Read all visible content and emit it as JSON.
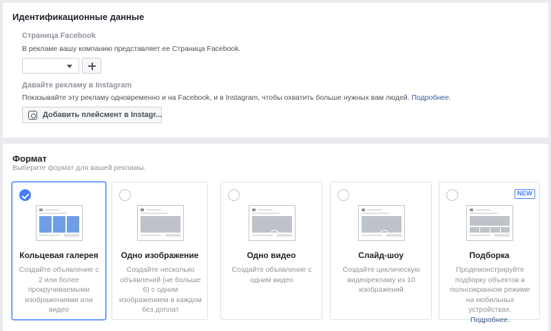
{
  "identity": {
    "title": "Идентификационные данные",
    "fb_heading": "Страница Facebook",
    "fb_desc": "В рекламе вашу компанию представляет ее Страница Facebook.",
    "page_select_value": "",
    "ig_heading": "Давайте рекламу в Instagram",
    "ig_desc": "Показывайте эту рекламу одновременно и на Facebook, и в Instagram, чтобы охватить больше нужных вам людей.",
    "ig_link": "Подробнее.",
    "ig_button": "Добавить плейсмент в Instagr..."
  },
  "format": {
    "title": "Формат",
    "subtitle": "Выберите формат для вашей рекламы.",
    "cards": [
      {
        "title": "Кольцевая галерея",
        "desc": "Создайте объявление с 2 или более прокручиваемыми изображениями или видео",
        "selected": true,
        "icon": "carousel-thumbnail-icon"
      },
      {
        "title": "Одно изображение",
        "desc": "Создайте несколько объявлений (не больше 6) с одним изображением в каждом без доплат",
        "selected": false,
        "icon": "single-image-thumbnail-icon"
      },
      {
        "title": "Одно видео",
        "desc": "Создайте объявление с одним видео",
        "selected": false,
        "icon": "video-thumbnail-icon"
      },
      {
        "title": "Слайд-шоу",
        "desc": "Создайте циклическую видеорекламу из 10 изображений",
        "selected": false,
        "icon": "slideshow-thumbnail-icon"
      },
      {
        "title": "Подборка",
        "desc": "Продемонстрируйте подборку объектов в полноэкранном режиме на мобильных устройствах.",
        "link": "Подробнее.",
        "badge": "NEW",
        "selected": false,
        "icon": "collection-thumbnail-icon"
      }
    ]
  },
  "colors": {
    "accent": "#4080ff",
    "link": "#365899",
    "background": "#e9ebee"
  }
}
